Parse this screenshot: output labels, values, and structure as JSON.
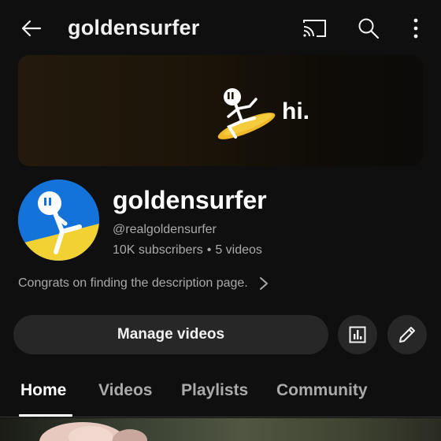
{
  "header": {
    "title": "goldensurfer",
    "back_icon": "arrow-left-icon",
    "cast_icon": "cast-icon",
    "search_icon": "search-icon",
    "more_icon": "more-vertical-icon"
  },
  "banner": {
    "text": "hi."
  },
  "channel": {
    "name": "goldensurfer",
    "handle": "@realgoldensurfer",
    "subscribers": "10K subscribers",
    "separator": "•",
    "videos": "5 videos",
    "description": "Congrats on finding the description page."
  },
  "actions": {
    "manage_label": "Manage videos",
    "analytics_icon": "analytics-icon",
    "edit_icon": "pencil-icon"
  },
  "tabs": [
    {
      "label": "Home",
      "active": true
    },
    {
      "label": "Videos",
      "active": false
    },
    {
      "label": "Playlists",
      "active": false
    },
    {
      "label": "Community",
      "active": false
    }
  ],
  "colors": {
    "background": "#0f0f0f",
    "button_bg": "#272727",
    "secondary_text": "#aaaaaa",
    "avatar_blue": "#1473d8",
    "avatar_yellow": "#f2d233"
  }
}
